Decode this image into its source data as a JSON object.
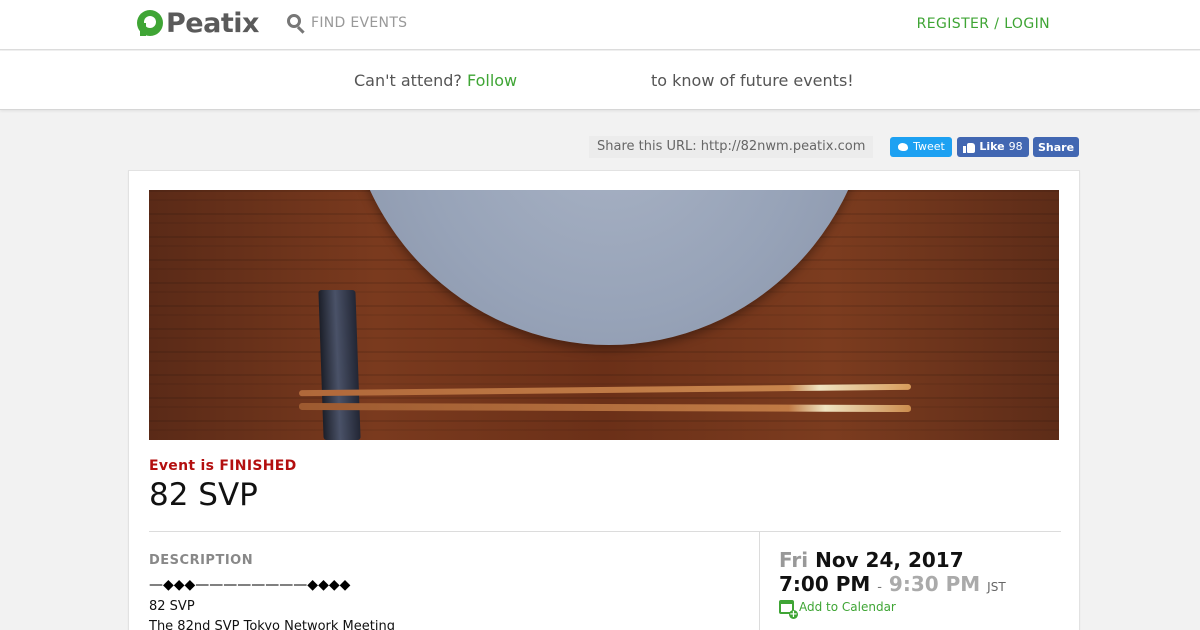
{
  "header": {
    "brand": "Peatix",
    "search_label": "FIND EVENTS",
    "auth_link": "REGISTER / LOGIN"
  },
  "follow_bar": {
    "prefix": "Can't attend?",
    "link": "Follow",
    "suffix": "to know of future events!"
  },
  "share": {
    "url_text": "Share this URL: http://82nwm.peatix.com",
    "tweet_label": "Tweet",
    "like_label": "Like",
    "like_count": "98",
    "share_label": "Share"
  },
  "event": {
    "status": "Event is FINISHED",
    "title": "82 SVP",
    "hero_icon": "event-cover-image",
    "description": {
      "heading": "DESCRIPTION",
      "lines": [
        "—◆◆◆————————◆◆◆◆",
        "82 SVP",
        "The 82nd SVP Tokyo Network Meeting"
      ]
    },
    "datetime": {
      "day_of_week": "Fri",
      "date": "Nov 24, 2017",
      "start_time": "7:00 PM",
      "separator": "-",
      "end_time": "9:30 PM",
      "timezone": "JST",
      "add_to_calendar": "Add to Calendar"
    }
  },
  "colors": {
    "brand_green": "#3fa535",
    "status_red": "#b30f0f",
    "twitter_blue": "#1da1f2",
    "facebook_blue": "#4267b2"
  }
}
